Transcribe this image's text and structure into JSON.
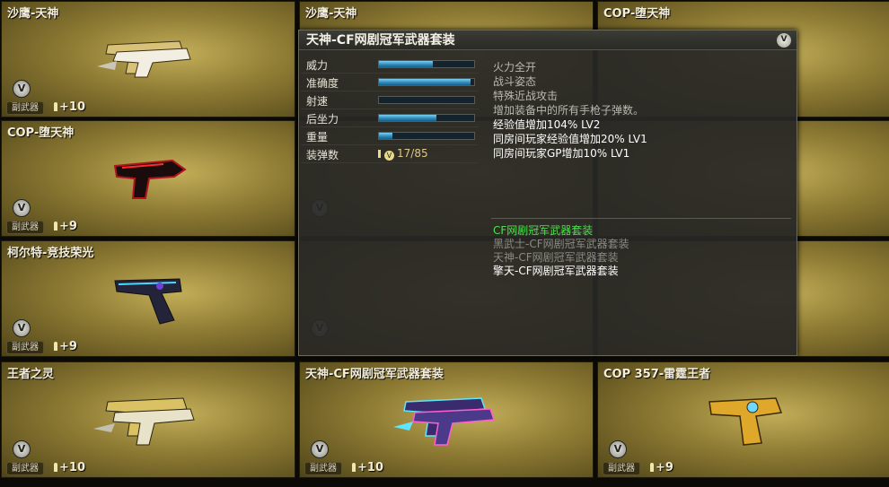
{
  "cards": [
    {
      "title": "沙鹰-天神",
      "type": "副武器",
      "ammo": "+10",
      "badge": "V",
      "weapon": "gold-deagle-pair"
    },
    {
      "title": "COP-堕天神",
      "type": "副武器",
      "ammo": "+9",
      "badge": "V",
      "weapon": "dark-dragon-pistol"
    },
    {
      "title": "柯尔特-竞技荣光",
      "type": "副武器",
      "ammo": "+9",
      "badge": "V",
      "weapon": "blue-colt"
    },
    {
      "title": "王者之灵",
      "type": "副武器",
      "ammo": "+10",
      "badge": "V",
      "weapon": "gold-deagle-pair"
    },
    {
      "title": "沙鹰-天神",
      "type": "",
      "ammo": "",
      "badge": "",
      "weapon": ""
    },
    {
      "title": "",
      "type": "",
      "ammo": "",
      "badge": "V",
      "weapon": ""
    },
    {
      "title": "",
      "type": "",
      "ammo": "",
      "badge": "V",
      "weapon": ""
    },
    {
      "title": "天神-CF网剧冠军武器套装",
      "type": "副武器",
      "ammo": "+10",
      "badge": "V",
      "weapon": "neon-deagle-pair"
    },
    {
      "title": "COP-堕天神",
      "type": "",
      "ammo": "",
      "badge": "",
      "weapon": ""
    },
    {
      "title": "",
      "type": "",
      "ammo": "",
      "badge": "",
      "weapon": ""
    },
    {
      "title": "",
      "type": "",
      "ammo": "",
      "badge": "",
      "weapon": ""
    },
    {
      "title": "COP 357-雷霆王者",
      "type": "副武器",
      "ammo": "+9",
      "badge": "V",
      "weapon": "gold-cop357"
    }
  ],
  "tooltip": {
    "title": "天神-CF网剧冠军武器套装",
    "badge": "V",
    "stats": [
      {
        "label": "威力",
        "value": 0.57
      },
      {
        "label": "准确度",
        "value": 0.96
      },
      {
        "label": "射速",
        "value": 0.0
      },
      {
        "label": "后坐力",
        "value": 0.6
      },
      {
        "label": "重量",
        "value": 0.14
      }
    ],
    "ammo_label": "装弹数",
    "ammo_badge": "V",
    "ammo_value": "17/85",
    "effects": [
      {
        "text": "火力全开",
        "color": "#b9b9b0"
      },
      {
        "text": "战斗姿态",
        "color": "#b9b9b0"
      },
      {
        "text": "特殊近战攻击",
        "color": "#b9b9b0"
      },
      {
        "text": "增加装备中的所有手枪子弹数。",
        "color": "#b9b9b0"
      },
      {
        "text": "经验值增加104% LV2",
        "color": "#ffffff"
      },
      {
        "text": "同房间玩家经验值增加20% LV1",
        "color": "#ffffff"
      },
      {
        "text": "同房间玩家GP增加10% LV1",
        "color": "#ffffff"
      }
    ],
    "sets": [
      {
        "text": "CF网剧冠军武器套装",
        "color": "#4fe04f"
      },
      {
        "text": "黑武士-CF网剧冠军武器套装",
        "color": "#8a8a84"
      },
      {
        "text": "天神-CF网剧冠军武器套装",
        "color": "#8a8a84"
      },
      {
        "text": "擎天-CF网剧冠军武器套装",
        "color": "#ffffff"
      }
    ]
  }
}
